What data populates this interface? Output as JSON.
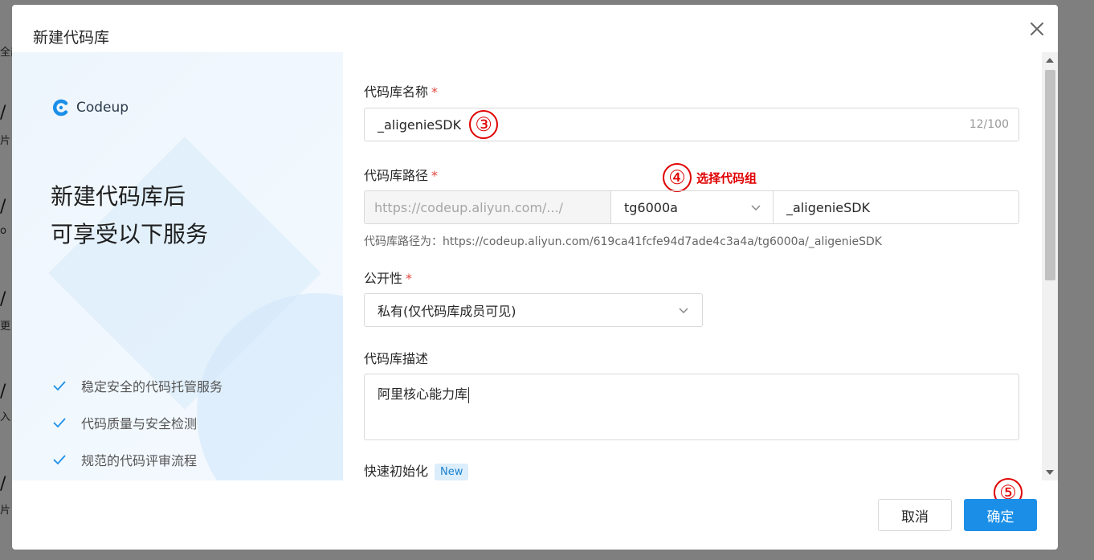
{
  "background": {
    "fragments": [
      "全部",
      "/",
      "片",
      "/",
      "o",
      "/",
      "更",
      "/ a",
      "入",
      "/",
      "片"
    ]
  },
  "modal": {
    "title": "新建代码库",
    "close_icon": "close-icon"
  },
  "left_panel": {
    "brand_name": "Codeup",
    "promo_line1": "新建代码库后",
    "promo_line2": "可享受以下服务",
    "features": [
      "稳定安全的代码托管服务",
      "代码质量与安全检测",
      "规范的代码评审流程"
    ]
  },
  "form": {
    "name_label": "代码库名称",
    "required_mark": "*",
    "name_value": "_aligenieSDK",
    "name_counter": "12/100",
    "path_label": "代码库路径",
    "path_prefix": "https://codeup.aliyun.com/.../",
    "path_group_value": "tg6000a",
    "path_name_value": "_aligenieSDK",
    "path_hint": "代码库路径为：https://codeup.aliyun.com/619ca41fcfe94d7ade4c3a4a/tg6000a/_aligenieSDK",
    "visibility_label": "公开性",
    "visibility_value": "私有(仅代码库成员可见)",
    "desc_label": "代码库描述",
    "desc_value": "阿里核心能力库",
    "quick_init_label": "快速初始化",
    "new_badge": "New"
  },
  "annotations": {
    "step3": "③",
    "step4": "④",
    "step4_text": "选择代码组",
    "step5": "⑤"
  },
  "footer": {
    "cancel_label": "取消",
    "ok_label": "确定"
  },
  "colors": {
    "primary": "#1b8fe8",
    "required": "#e0463c",
    "annotation": "#e00000"
  }
}
